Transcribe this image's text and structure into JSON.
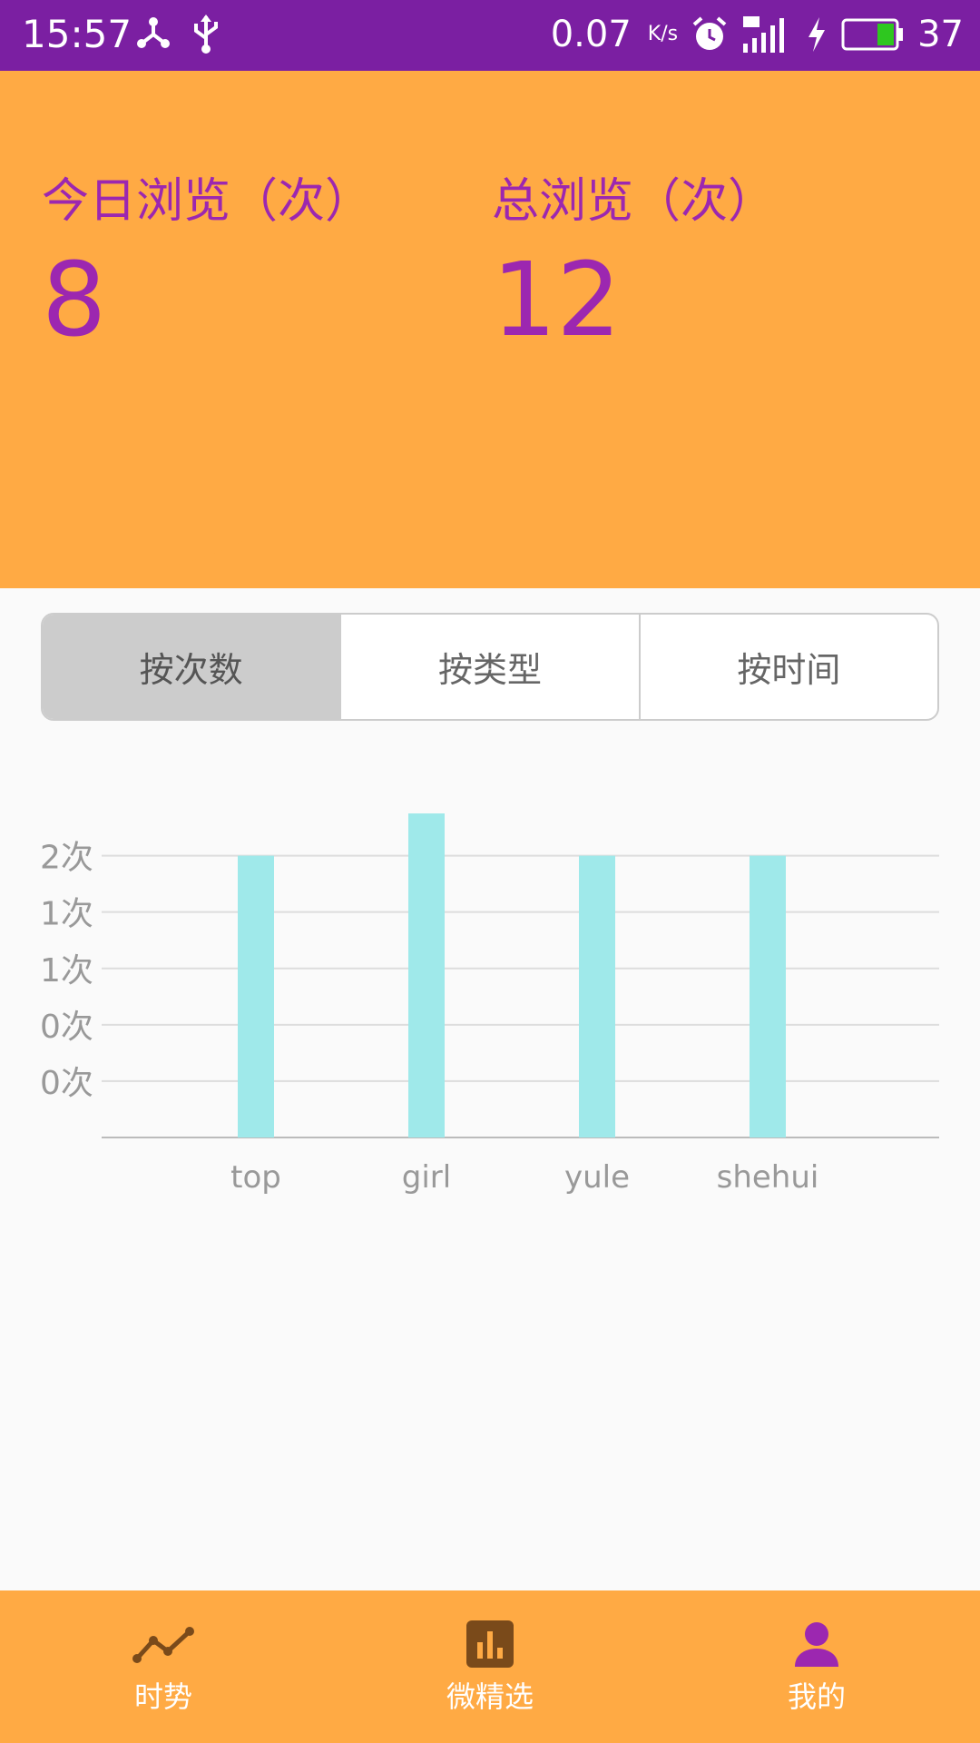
{
  "status_bar": {
    "time": "15:57",
    "speed": "0.07",
    "speed_unit": "K/s",
    "battery_percent": "37"
  },
  "header": {
    "today_label": "今日浏览（次）",
    "today_value": "8",
    "total_label": "总浏览（次）",
    "total_value": "12",
    "background_color": "#FFAA44",
    "text_color": "#9C27B0"
  },
  "segmented": {
    "options": [
      "按次数",
      "按类型",
      "按时间"
    ],
    "selected_index": 0
  },
  "chart_data": {
    "type": "bar",
    "categories": [
      "top",
      "girl",
      "yule",
      "shehui"
    ],
    "values": [
      2,
      2.3,
      2,
      2
    ],
    "y_tick_labels": [
      "0次",
      "0次",
      "1次",
      "1次",
      "2次"
    ],
    "ylim": [
      0,
      2.5
    ],
    "grid": true,
    "bar_color": "#9FE9EA"
  },
  "bottom_nav": {
    "items": [
      {
        "label": "时势",
        "icon": "trend-line-icon"
      },
      {
        "label": "微精选",
        "icon": "bar-chart-icon"
      },
      {
        "label": "我的",
        "icon": "person-icon"
      }
    ],
    "selected_index": 2,
    "icon_color_inactive": "#7A4A1A",
    "icon_color_active": "#9C27B0"
  }
}
